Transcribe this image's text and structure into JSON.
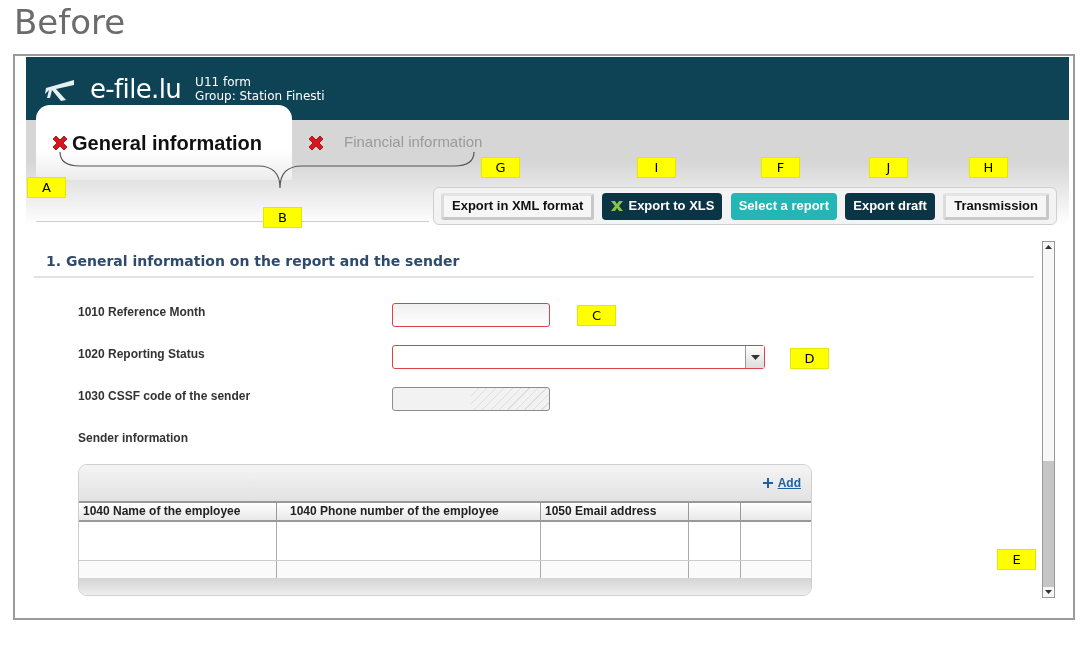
{
  "caption": "Before",
  "header": {
    "brand": "e-file.lu",
    "form": "U11 form",
    "group": "Group: Station Finesti"
  },
  "tabs": [
    {
      "label": "General information",
      "selected": true,
      "error": true
    },
    {
      "label": "Financial information",
      "selected": false,
      "error": true
    }
  ],
  "toolbar": [
    {
      "label": "Export in XML format",
      "kind": "light",
      "icon": false
    },
    {
      "label": "Export to XLS",
      "kind": "dark",
      "icon": true
    },
    {
      "label": "Select a report",
      "kind": "teal",
      "icon": false
    },
    {
      "label": "Export draft",
      "kind": "dark",
      "icon": false
    },
    {
      "label": "Transmission",
      "kind": "light",
      "icon": false
    }
  ],
  "section": {
    "title": "1. General information on the report and the sender",
    "fields": [
      {
        "label": "1010 Reference Month",
        "kind": "text",
        "invalid": true
      },
      {
        "label": "1020 Reporting Status",
        "kind": "select",
        "invalid": true
      },
      {
        "label": "1030 CSSF code of the sender",
        "kind": "readonly",
        "invalid": false
      }
    ],
    "subsection": "Sender information",
    "table": {
      "add": "Add",
      "columns": [
        "1040 Name of the employee",
        "1040 Phone number of the employee",
        "1050 Email address"
      ]
    }
  },
  "callouts": [
    {
      "label": "A"
    },
    {
      "label": "B"
    },
    {
      "label": "G"
    },
    {
      "label": "I"
    },
    {
      "label": "F"
    },
    {
      "label": "J"
    },
    {
      "label": "H"
    },
    {
      "label": "C"
    },
    {
      "label": "D"
    },
    {
      "label": "E"
    }
  ]
}
